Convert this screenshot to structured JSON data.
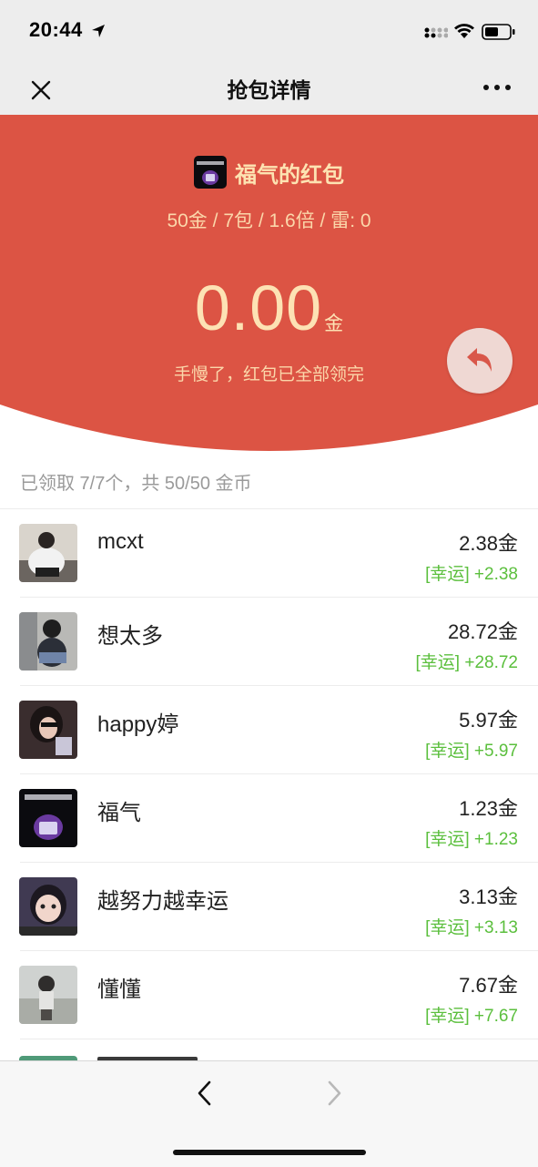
{
  "status_bar": {
    "time": "20:44"
  },
  "nav": {
    "title": "抢包详情"
  },
  "packet": {
    "sender_name": "福气的红包",
    "info": "50金 / 7包 / 1.6倍 / 雷: 0",
    "amount": "0.00",
    "amount_unit": "金",
    "message": "手慢了，红包已全部领完"
  },
  "summary": "已领取 7/7个，共 50/50 金币",
  "recipients": [
    {
      "name": "mcxt",
      "amount": "2.38金",
      "lucky": "[幸运] +2.38"
    },
    {
      "name": "想太多",
      "amount": "28.72金",
      "lucky": "[幸运] +28.72"
    },
    {
      "name": "happy婷",
      "amount": "5.97金",
      "lucky": "[幸运] +5.97"
    },
    {
      "name": "福气",
      "amount": "1.23金",
      "lucky": "[幸运] +1.23"
    },
    {
      "name": "越努力越幸运",
      "amount": "3.13金",
      "lucky": "[幸运] +3.13"
    },
    {
      "name": "懂懂",
      "amount": "7.67金",
      "lucky": "[幸运] +7.67"
    }
  ],
  "colors": {
    "header_red": "#dc5444",
    "gold_text": "#fde2b4",
    "lucky_green": "#5bbf3d"
  }
}
